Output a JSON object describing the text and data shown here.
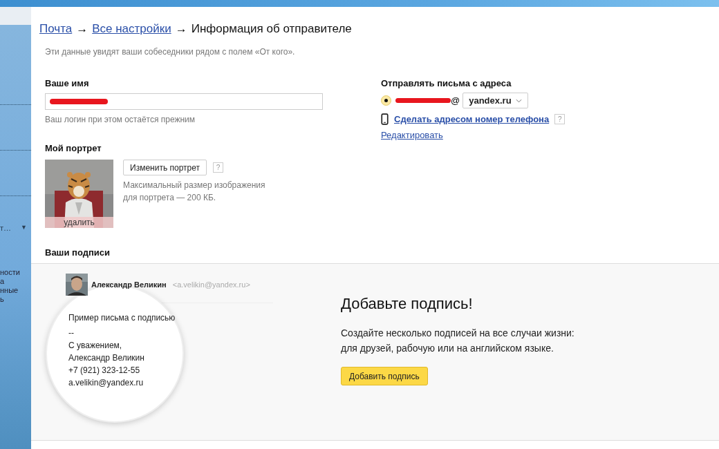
{
  "sidebar": {
    "fragments": [
      {
        "kind": "menu",
        "text": "т…",
        "caret": "▼"
      },
      {
        "kind": "text",
        "text": "ности"
      },
      {
        "kind": "text",
        "text": "а"
      },
      {
        "kind": "text",
        "text": "нные"
      },
      {
        "kind": "text",
        "text": "ь"
      }
    ]
  },
  "breadcrumb": {
    "links": [
      "Почта",
      "Все настройки"
    ],
    "separator": "→",
    "current": "Информация об отправителе"
  },
  "description": "Эти данные увидят ваши собеседники рядом с полем «От кого».",
  "name_section": {
    "label": "Ваше имя",
    "redacted": true,
    "hint": "Ваш логин при этом остаётся прежним"
  },
  "portrait": {
    "label": "Мой портрет",
    "delete": "удалить",
    "change_button": "Изменить портрет",
    "help": "?",
    "note": [
      "Максимальный размер изображения",
      "для портрета — 200 КБ."
    ]
  },
  "sender": {
    "label": "Отправлять письма с адреса",
    "addresses": [
      {
        "selected": true,
        "login_redacted": true,
        "at": "@",
        "domain": "yandex.ru"
      }
    ],
    "phone_link": "Сделать адресом номер телефона",
    "help": "?",
    "edit_link": "Редактировать"
  },
  "signatures": {
    "label": "Ваши подписи",
    "example": {
      "name": "Александр Великин",
      "email": "<a.velikin@yandex.ru>",
      "lines": [
        "Пример письма с подписью",
        "--",
        "С уважением,",
        "Александр Великин",
        "+7 (921) 323-12-55",
        "a.velikin@yandex.ru"
      ]
    },
    "title": "Добавьте подпись!",
    "text": [
      "Создайте несколько подписей на все случаи жизни:",
      "для друзей, рабочую или на английском языке."
    ],
    "button": "Добавить подпись"
  }
}
